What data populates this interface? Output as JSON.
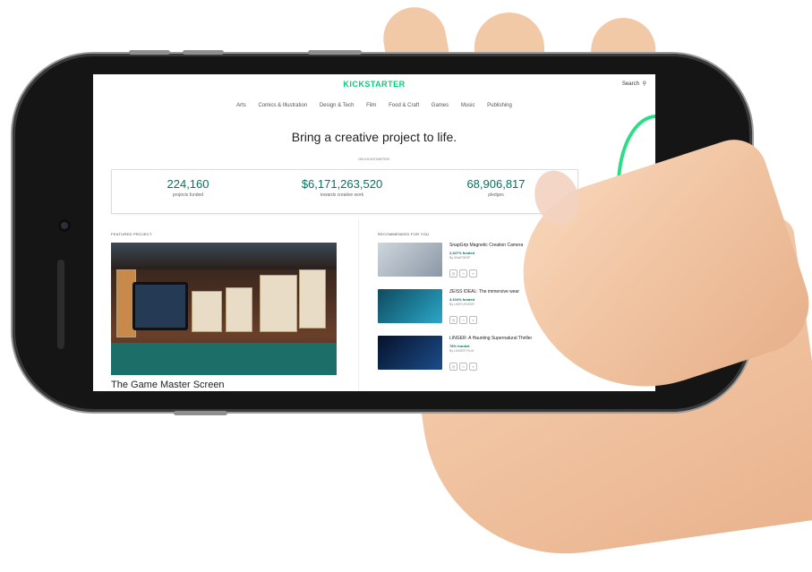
{
  "site": {
    "logo": "KICKSTARTER",
    "search_label": "Search",
    "nav": [
      "Arts",
      "Comics & Illustration",
      "Design & Tech",
      "Film",
      "Food & Craft",
      "Games",
      "Music",
      "Publishing"
    ],
    "headline": "Bring a creative project to life.",
    "subheadline": "ON KICKSTARTER:",
    "stats": [
      {
        "value": "224,160",
        "label": "projects funded"
      },
      {
        "value": "$6,171,263,520",
        "label": "towards creative work"
      },
      {
        "value": "68,906,817",
        "label": "pledges"
      }
    ],
    "featured": {
      "section_label": "FEATURED PROJECT",
      "title": "The Game Master Screen"
    },
    "recommended": {
      "section_label": "RECOMMENDED FOR YOU",
      "items": [
        {
          "title": "SnapGrip Magnetic Creation Camera",
          "funded": "2,347% funded",
          "byline": "By SNAPGRIP"
        },
        {
          "title": "ZEISS IDEAL: The immersive wear",
          "funded": "3,104% funded",
          "byline": "By LIMITLESSVR"
        },
        {
          "title": "LINGER: A Haunting Supernatural Thriller",
          "funded": "78% funded",
          "byline": "By LINGER FILM"
        }
      ]
    }
  },
  "colors": {
    "brand": "#05ce78",
    "stat_text": "#037362",
    "phone_body": "#151515"
  }
}
